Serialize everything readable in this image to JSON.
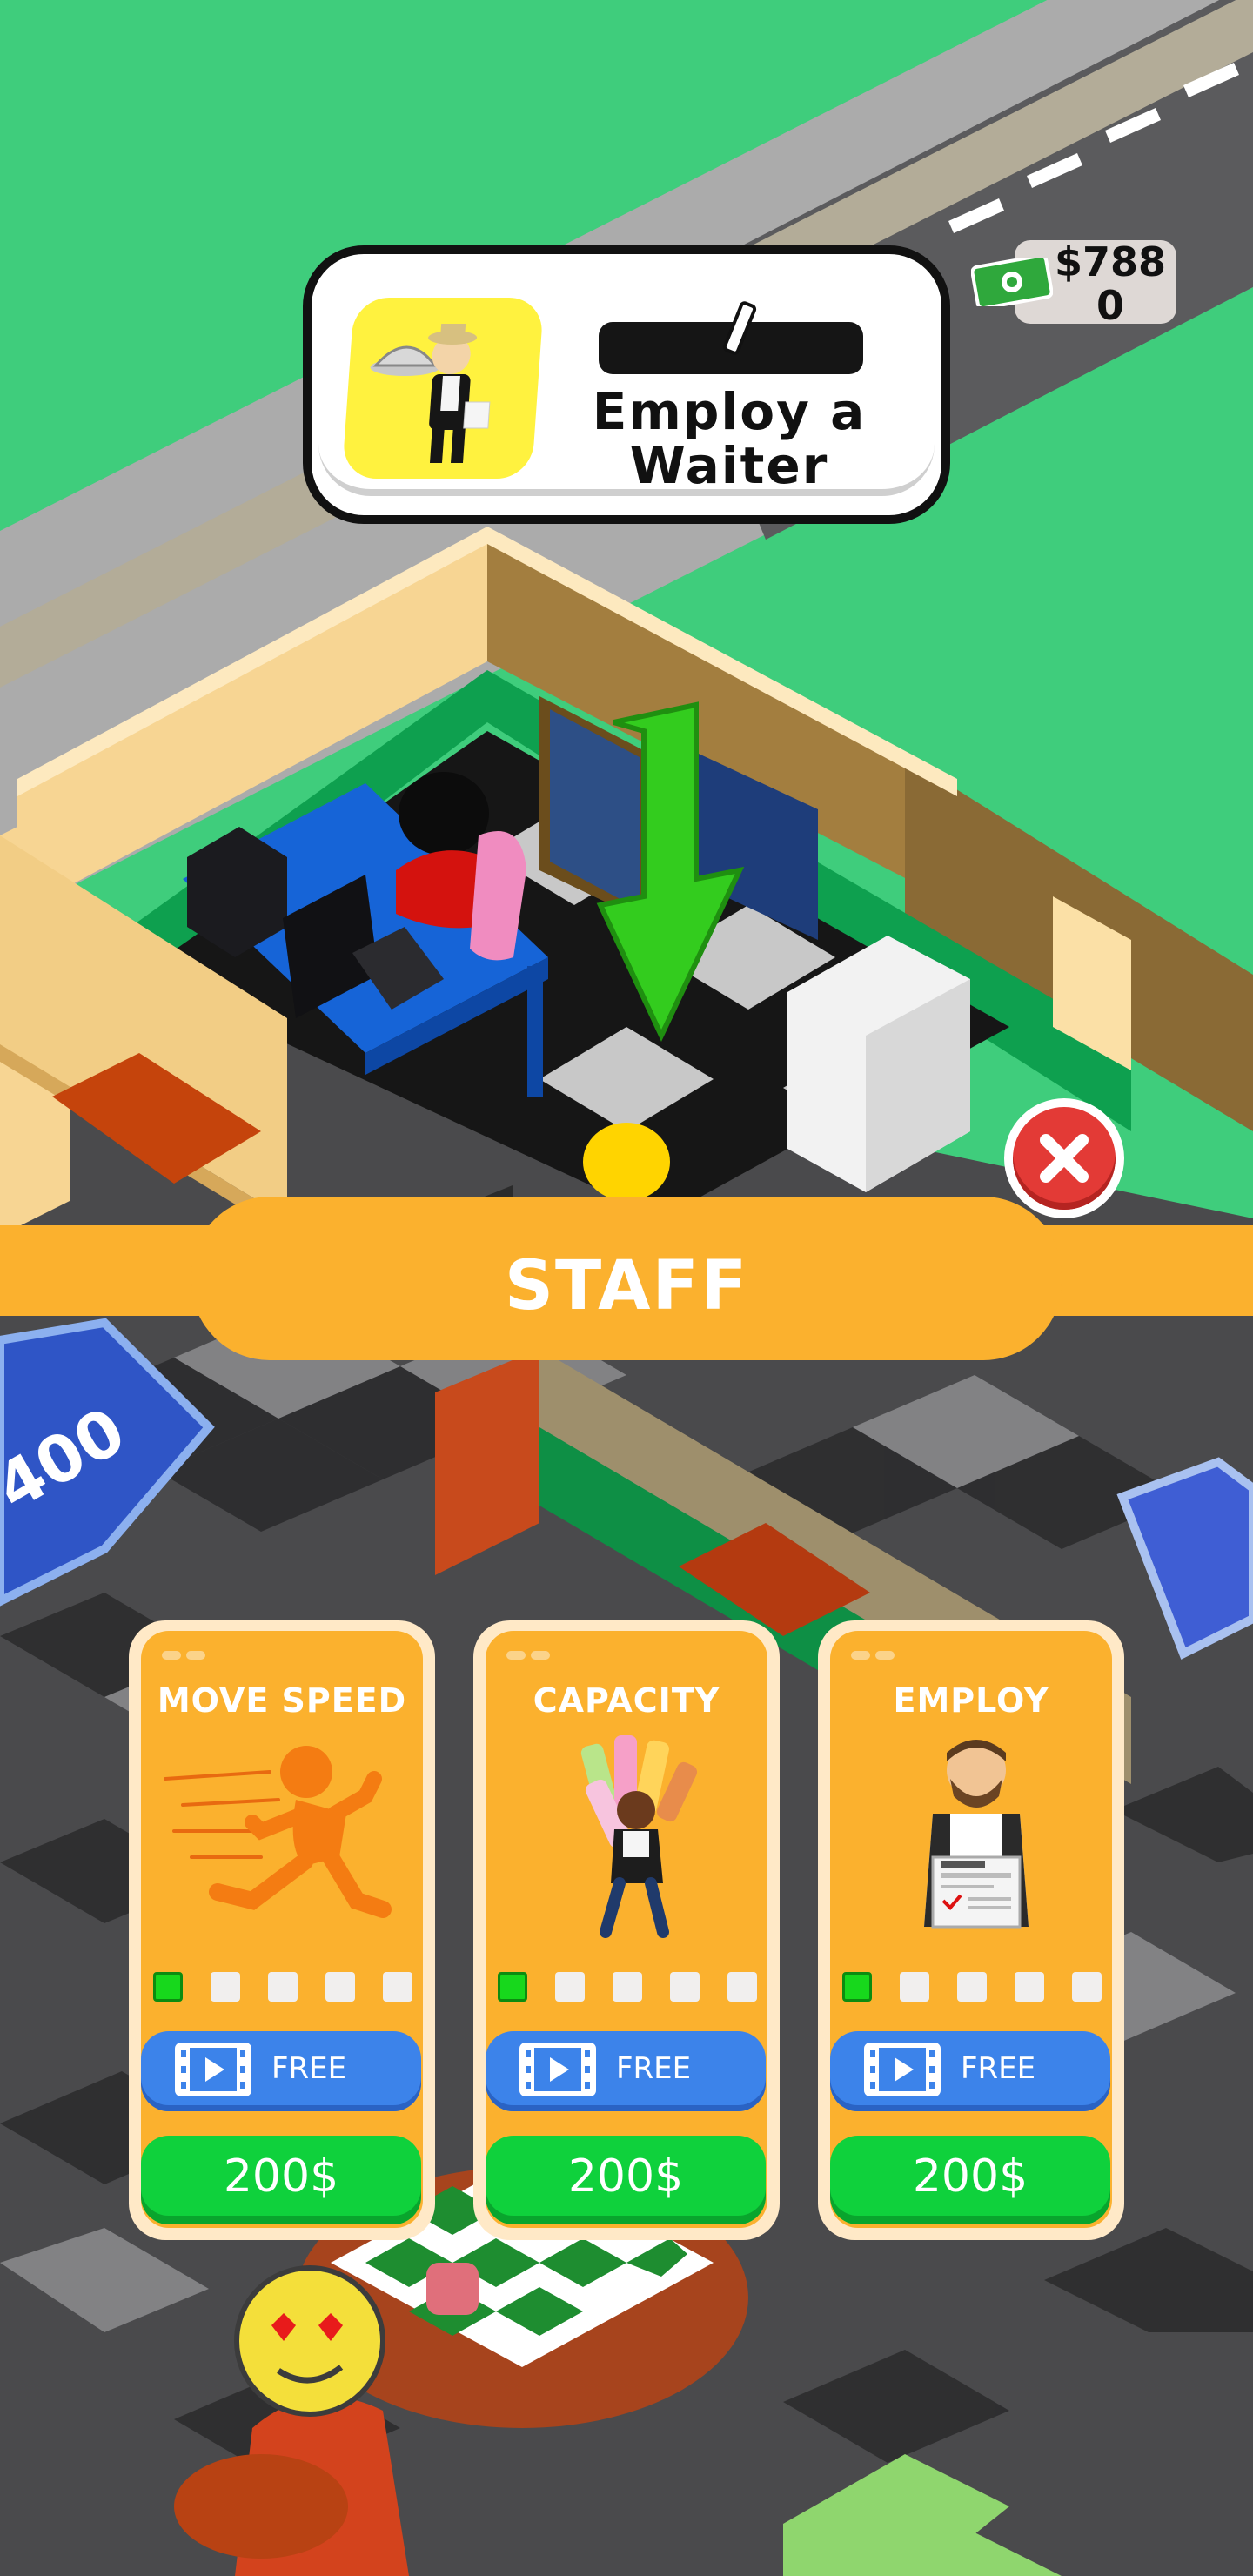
{
  "task": {
    "label": "Employ a\nWaiter",
    "progress": 0
  },
  "money": {
    "amount": "$788\n0"
  },
  "panel": {
    "title": "STAFF"
  },
  "floor_sign": {
    "value": "400"
  },
  "cards": [
    {
      "title": "MOVE SPEED",
      "level": 1,
      "max_level": 5,
      "free_label": "FREE",
      "price_label": "200$",
      "icon": "running-figure-icon"
    },
    {
      "title": "CAPACITY",
      "level": 1,
      "max_level": 5,
      "free_label": "FREE",
      "price_label": "200$",
      "icon": "waiter-carrying-drinks-icon"
    },
    {
      "title": "EMPLOY",
      "level": 1,
      "max_level": 5,
      "free_label": "FREE",
      "price_label": "200$",
      "icon": "chef-with-newspaper-icon"
    }
  ],
  "colors": {
    "panel_orange": "#fbb12e",
    "free_blue": "#3c83ea",
    "buy_green": "#0fd13c",
    "close_red": "#e33a36",
    "grass": "#3fcd7c"
  }
}
